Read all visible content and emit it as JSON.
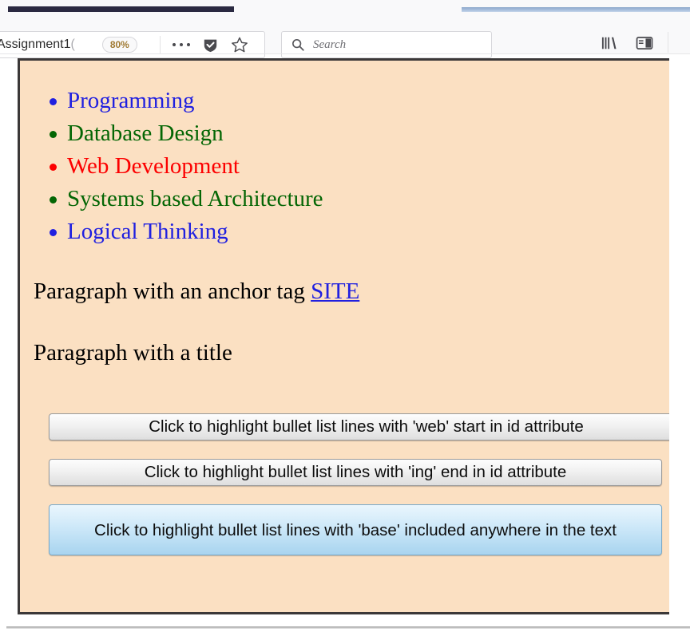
{
  "browser": {
    "tab_strip": {
      "active_tab_color": "#2b2a41",
      "inactive_tab_color": "#a9c0dd"
    },
    "url_bar": {
      "value": "Assignment1",
      "value_dim_suffix": "(",
      "zoom_level": "80%",
      "ellipsis_label": "•••",
      "shield_icon": "shield-icon",
      "star_icon": "star-icon"
    },
    "search_bar": {
      "placeholder": "Search",
      "icon": "search-icon"
    },
    "right_icons": [
      {
        "name": "library-icon"
      },
      {
        "name": "sidebar-icon"
      }
    ]
  },
  "page": {
    "background_color": "#fbe0c2",
    "border_color": "#3b3838",
    "bullet_list": [
      {
        "text": "Programming",
        "color": "#2020e0"
      },
      {
        "text": "Database Design",
        "color": "#046604"
      },
      {
        "text": "Web Development",
        "color": "#fc0000"
      },
      {
        "text": "Systems based Architecture",
        "color": "#046604"
      },
      {
        "text": "Logical Thinking",
        "color": "#2020e0"
      }
    ],
    "paragraphs": {
      "anchor_paragraph_prefix": "Paragraph with an anchor tag ",
      "anchor_link_text": "SITE",
      "anchor_link_color": "#2020e0",
      "title_paragraph": "Paragraph with a title"
    },
    "buttons": [
      {
        "id": "btn-web",
        "label": "Click to highlight bullet list lines with 'web' start in id attribute",
        "style": "gray"
      },
      {
        "id": "btn-ing",
        "label": "Click to highlight bullet list lines with 'ing' end in id attribute",
        "style": "gray"
      },
      {
        "id": "btn-base",
        "label": "Click to highlight bullet list lines with 'base' included anywhere in the text",
        "style": "blue"
      }
    ]
  }
}
